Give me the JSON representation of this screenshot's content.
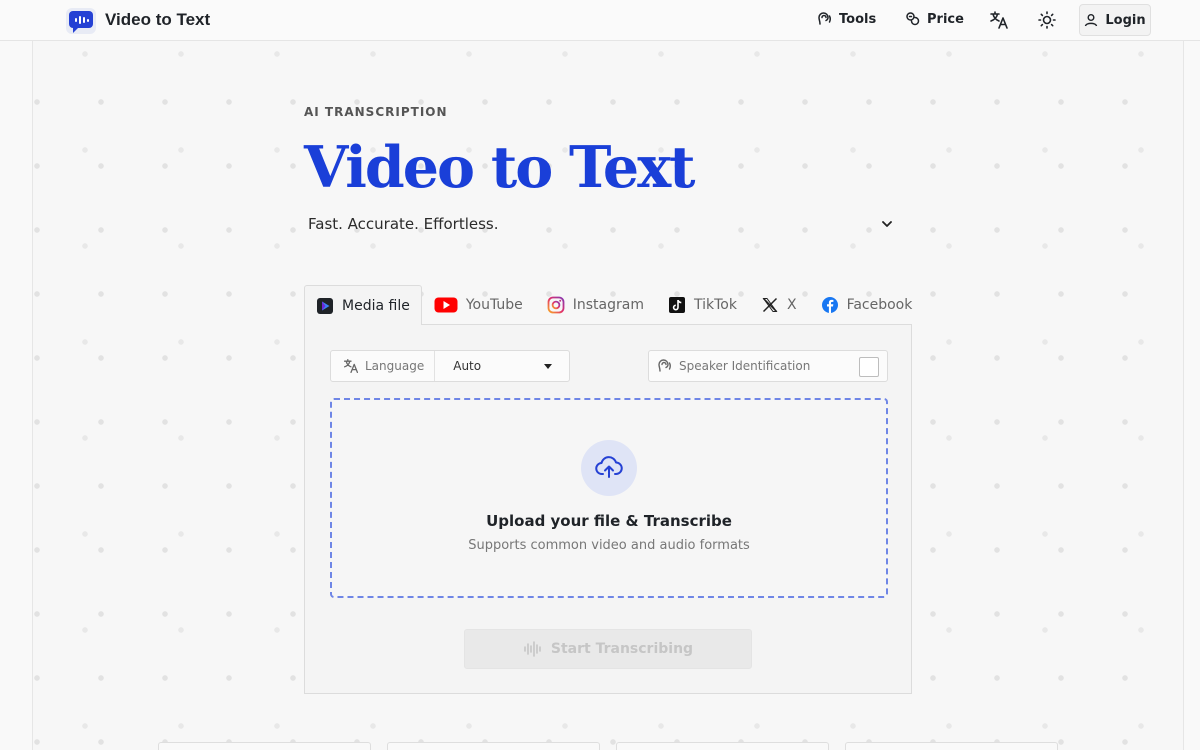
{
  "header": {
    "brand": "Video to Text",
    "nav": [
      {
        "label": "Tools",
        "icon": "ear-icon"
      },
      {
        "label": "Price",
        "icon": "coins-icon"
      }
    ],
    "login_label": "Login"
  },
  "hero": {
    "eyebrow": "AI TRANSCRIPTION",
    "title": "Video to Text",
    "tagline": "Fast. Accurate. Effortless."
  },
  "tabs": [
    {
      "label": "Media file",
      "active": true,
      "icon": "media-file-icon"
    },
    {
      "label": "YouTube",
      "icon": "youtube-icon"
    },
    {
      "label": "Instagram",
      "icon": "instagram-icon"
    },
    {
      "label": "TikTok",
      "icon": "tiktok-icon"
    },
    {
      "label": "X",
      "icon": "x-icon"
    },
    {
      "label": "Facebook",
      "icon": "facebook-icon"
    }
  ],
  "options": {
    "language_label": "Language",
    "language_value": "Auto",
    "speaker_label": "Speaker Identification",
    "speaker_checked": false
  },
  "upload": {
    "title": "Upload your file & Transcribe",
    "subtitle": "Supports common video and audio formats"
  },
  "start_label": "Start Transcribing",
  "colors": {
    "accent": "#1a3fd8",
    "dashed_border": "#6f86e6",
    "youtube": "#ff0000",
    "facebook": "#1877f2"
  }
}
